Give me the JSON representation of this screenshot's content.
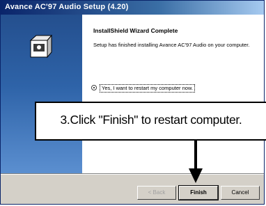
{
  "window": {
    "title": "Avance AC'97 Audio Setup (4.20)"
  },
  "wizard": {
    "heading": "InstallShield Wizard Complete",
    "description": "Setup has finished installing Avance AC'97 Audio on your computer.",
    "radio_option": "Yes, I want to restart my computer now."
  },
  "buttons": {
    "back": "< Back",
    "finish": "Finish",
    "cancel": "Cancel"
  },
  "callout": {
    "text": "3.Click \"Finish\" to restart computer."
  },
  "icons": {
    "setup": "installer-box-icon",
    "arrow": "down-arrow-icon"
  },
  "colors": {
    "titlebar": "#0a246a",
    "banner": "#2e63a8",
    "dialog_face": "#d4d0c8"
  }
}
